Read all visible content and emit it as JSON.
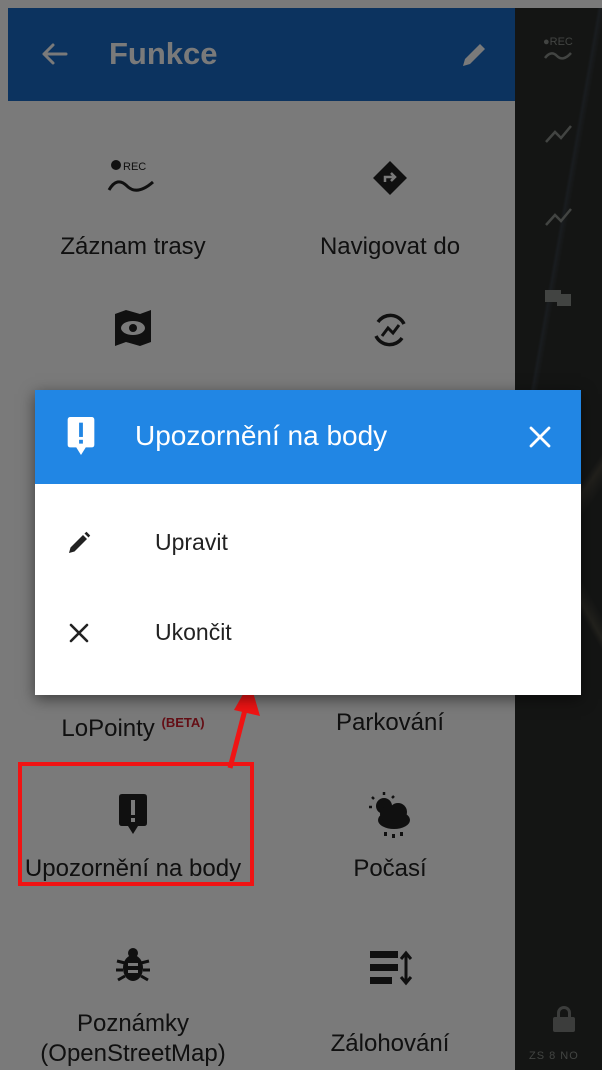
{
  "header": {
    "title": "Funkce",
    "back_icon": "arrow-left-icon",
    "edit_icon": "pencil-icon"
  },
  "grid": {
    "items": [
      {
        "label": "Záznam trasy",
        "icon": "track-record-icon"
      },
      {
        "label": "Navigovat do",
        "icon": "navigate-icon"
      },
      {
        "label": "",
        "icon": "map-eye-icon"
      },
      {
        "label": "",
        "icon": "sync-icon"
      },
      {
        "label": "LoPointy",
        "badge": "(BETA)",
        "icon": ""
      },
      {
        "label": "Parkování",
        "icon": ""
      },
      {
        "label": "Upozornění na body",
        "icon": "point-alert-icon"
      },
      {
        "label": "Počasí",
        "icon": "weather-icon"
      },
      {
        "label": "Poznámky (OpenStreetMap)",
        "line1": "Poznámky",
        "line2": "(OpenStreetMap)",
        "icon": "bug-icon"
      },
      {
        "label": "Zálohování",
        "icon": "backup-icon"
      }
    ]
  },
  "dialog": {
    "title": "Upozornění na body",
    "title_icon": "point-alert-icon",
    "close_icon": "close-icon",
    "options": [
      {
        "label": "Upravit",
        "icon": "pencil-icon"
      },
      {
        "label": "Ukončit",
        "icon": "close-icon"
      }
    ]
  },
  "map": {
    "rec_label": "●REC",
    "scale_text": "ZS 8 NO"
  },
  "colors": {
    "appbar": "#1b6cc6",
    "dialog_header": "#2186e4",
    "highlight": "#f01414",
    "beta": "#d21f2d"
  }
}
